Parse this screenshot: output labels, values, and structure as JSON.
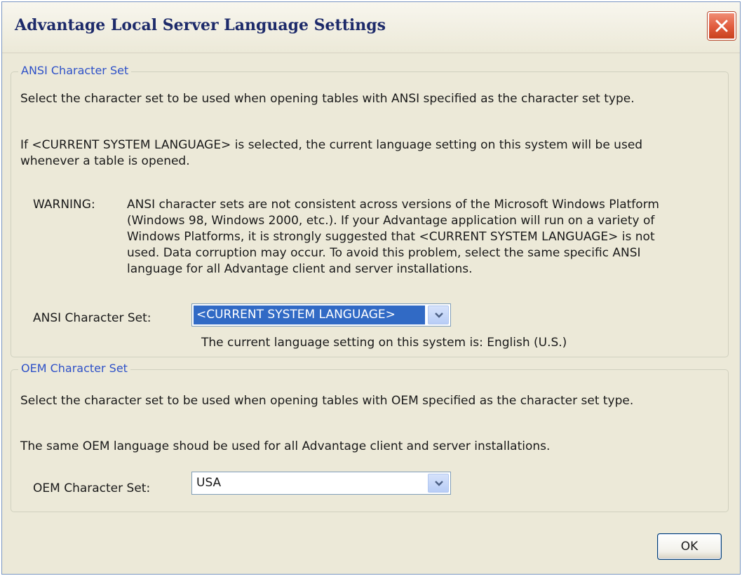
{
  "window": {
    "title": "Advantage Local Server Language Settings"
  },
  "ansi": {
    "legend": "ANSI Character Set",
    "description": "Select the character set to be used when opening tables with ANSI specified as the character set type.",
    "current_note_line1": "If <CURRENT SYSTEM LANGUAGE> is selected, the current language setting on this system will be used",
    "current_note_line2": "whenever a table is opened.",
    "warning_label": "WARNING:",
    "warning_line1": "ANSI character sets are not consistent across versions of the Microsoft Windows Platform",
    "warning_line2": "(Windows 98, Windows 2000, etc.). If your Advantage application will run on a variety of",
    "warning_line3": "Windows Platforms, it is strongly suggested that <CURRENT SYSTEM LANGUAGE> is not",
    "warning_line4": "used. Data corruption may occur. To avoid this problem, select the same specific ANSI",
    "warning_line5": "language for all Advantage client and server installations.",
    "field_label": "ANSI Character Set:",
    "selected_value": "<CURRENT SYSTEM LANGUAGE>",
    "current_setting_text": "The current language setting on this system is:  English (U.S.)"
  },
  "oem": {
    "legend": "OEM Character Set",
    "description": "Select the character set to be used when opening tables with OEM specified as the character set type.",
    "note": "The same OEM language shoud be used for all Advantage client and server installations.",
    "field_label": "OEM Character Set:",
    "selected_value": "USA"
  },
  "buttons": {
    "ok_label": "OK"
  },
  "icons": {
    "close": "close-icon",
    "dropdown": "chevron-down-icon"
  },
  "colors": {
    "title_text": "#1d2a6a",
    "legend_text": "#2e51c8",
    "selection": "#316ac5",
    "close_button": "#e05a3c",
    "dialog_background": "#ece9d8"
  }
}
